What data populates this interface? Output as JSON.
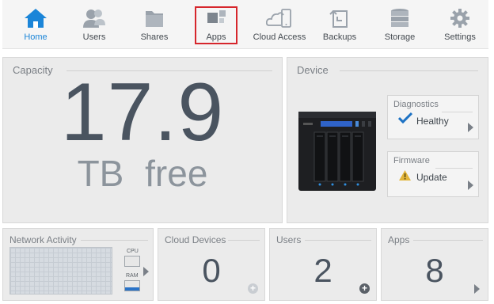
{
  "nav": {
    "items": [
      {
        "label": "Home",
        "icon": "home-icon"
      },
      {
        "label": "Users",
        "icon": "users-icon"
      },
      {
        "label": "Shares",
        "icon": "folder-icon"
      },
      {
        "label": "Apps",
        "icon": "apps-icon"
      },
      {
        "label": "Cloud Access",
        "icon": "cloud-access-icon"
      },
      {
        "label": "Backups",
        "icon": "backups-icon"
      },
      {
        "label": "Storage",
        "icon": "storage-icon"
      },
      {
        "label": "Settings",
        "icon": "gear-icon"
      }
    ],
    "active": "Home",
    "highlighted": "Apps"
  },
  "capacity": {
    "title": "Capacity",
    "value": "17.9",
    "unit": "TB free"
  },
  "device": {
    "title": "Device",
    "diagnostics": {
      "title": "Diagnostics",
      "status": "Healthy"
    },
    "firmware": {
      "title": "Firmware",
      "status": "Update"
    }
  },
  "network": {
    "title": "Network Activity",
    "cpu_label": "CPU",
    "ram_label": "RAM",
    "cpu_level": 0.0,
    "ram_level": 0.3
  },
  "tiles": {
    "cloud_devices": {
      "title": "Cloud Devices",
      "count": "0"
    },
    "users": {
      "title": "Users",
      "count": "2"
    },
    "apps": {
      "title": "Apps",
      "count": "8"
    }
  },
  "colors": {
    "accent": "#1b85d8",
    "highlight_border": "#d6262c",
    "healthy_check": "#1d72c4",
    "warning": "#e2b53a"
  }
}
